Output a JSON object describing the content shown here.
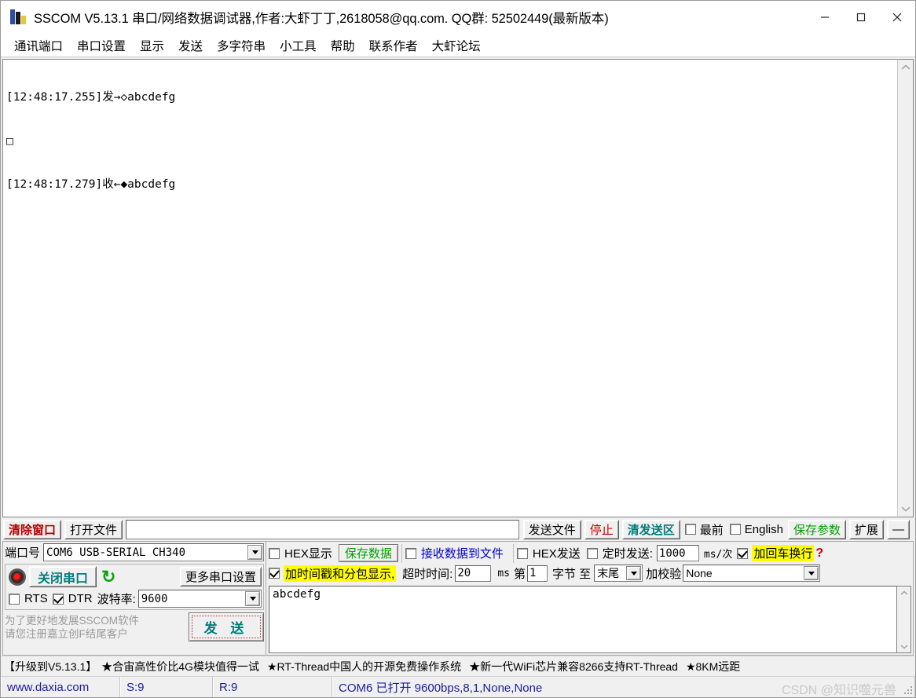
{
  "window": {
    "title": "SSCOM V5.13.1 串口/网络数据调试器,作者:大虾丁丁,2618058@qq.com. QQ群: 52502449(最新版本)",
    "icon": "sscom-bars-icon",
    "minimize": "—",
    "maximize": "□",
    "close": "✕"
  },
  "menu": {
    "items": [
      {
        "label": "通讯端口"
      },
      {
        "label": "串口设置"
      },
      {
        "label": "显示"
      },
      {
        "label": "发送"
      },
      {
        "label": "多字符串"
      },
      {
        "label": "小工具"
      },
      {
        "label": "帮助"
      },
      {
        "label": "联系作者"
      },
      {
        "label": "大虾论坛"
      }
    ]
  },
  "terminal": {
    "lines": [
      "[12:48:17.255]发→◇abcdefg",
      "□",
      "[12:48:17.279]收←◆abcdefg"
    ],
    "scroll_up": "⌃",
    "scroll_down": "⌄"
  },
  "sendbar": {
    "clear_window": "清除窗口",
    "open_file": "打开文件",
    "filepath_value": "",
    "filepath_placeholder": "",
    "send_file": "发送文件",
    "stop": "停止",
    "clear_send": "清发送区",
    "topmost_label": "最前",
    "topmost_checked": false,
    "english_label": "English",
    "english_checked": false,
    "save_params": "保存参数",
    "extend": "扩展",
    "collapse": "—"
  },
  "port_panel": {
    "port_label": "端口号",
    "port_value": "COM6 USB-SERIAL CH340",
    "close_port_button": "关闭串口",
    "refresh_icon": "refresh-icon",
    "more_settings_button": "更多串口设置",
    "rts_label": "RTS",
    "rts_checked": false,
    "dtr_label": "DTR",
    "dtr_checked": true,
    "baud_label": "波特率:",
    "baud_value": "9600",
    "register_note_line1": "为了更好地发展SSCOM软件",
    "register_note_line2": "请您注册嘉立创F结尾客户",
    "send_button": "发 送"
  },
  "options": {
    "hex_display_label": "HEX显示",
    "hex_display_checked": false,
    "save_data_button": "保存数据",
    "recv_to_file_label": "接收数据到文件",
    "recv_to_file_checked": false,
    "hex_send_label": "HEX发送",
    "hex_send_checked": false,
    "timed_send_label": "定时发送:",
    "timed_send_checked": false,
    "timed_send_value": "1000",
    "timed_send_unit": "ms/次",
    "crlf_label": "加回车换行",
    "crlf_checked": true,
    "help_marker": "?",
    "timestamp_label": "加时间戳和分包显示,",
    "timestamp_checked": true,
    "timeout_label": "超时时间:",
    "timeout_value": "20",
    "timeout_unit": "ms",
    "byte_from_label": "第",
    "byte_from_value": "1",
    "byte_label": "字节 至",
    "byte_to_value": "末尾",
    "checksum_label": "加校验",
    "checksum_value": "None"
  },
  "send_area": {
    "value": "abcdefg",
    "scroll_up": "⌃",
    "scroll_down": "⌄"
  },
  "adbar": {
    "text_prefix": "【升级到V5.13.1】",
    "item1": "★合宙高性价比4G模块值得一试",
    "item2": "★RT-Thread中国人的开源免费操作系统",
    "item3": "★新一代WiFi芯片兼容8266支持RT-Thread",
    "item4": "★8KM远距"
  },
  "status": {
    "site": "www.daxia.com",
    "sent": "S:9",
    "received": "R:9",
    "connection": "COM6 已打开  9600bps,8,1,None,None",
    "watermark": "CSDN @知识噬元兽"
  },
  "colors": {
    "accent_red": "#b00000",
    "accent_teal": "#007b7b",
    "accent_green": "#00a000",
    "accent_blue": "#0000cc",
    "highlight": "#ffff00",
    "status_text": "#1c1c9c"
  }
}
